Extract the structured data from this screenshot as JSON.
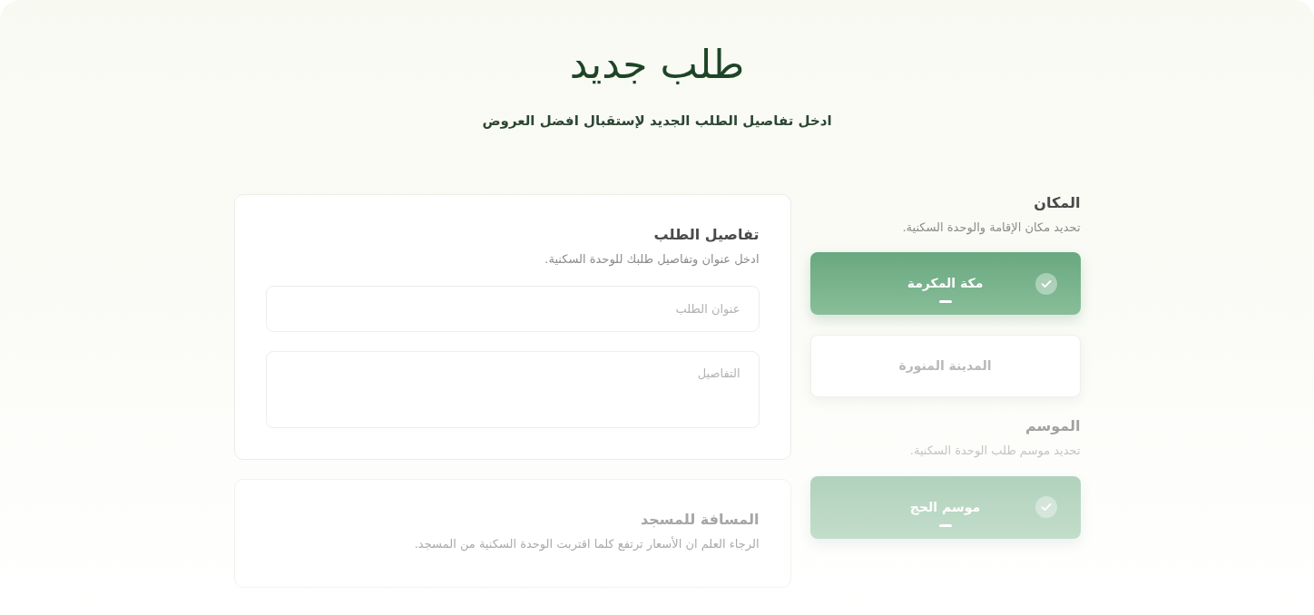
{
  "header": {
    "title": "طلب جديد",
    "subtitle": "ادخل تفاصيل الطلب الجديد لإستقبال افضل العروض"
  },
  "location": {
    "title": "المكان",
    "subtitle": "تحديد مكان الإقامة والوحدة السكنية.",
    "options": [
      {
        "label": "مكة المكرمة",
        "selected": true
      },
      {
        "label": "المدينة المنورة",
        "selected": false
      }
    ]
  },
  "season": {
    "title": "الموسم",
    "subtitle": "تحديد موسم طلب الوحدة السكنية.",
    "options": [
      {
        "label": "موسم الحج",
        "selected": true
      }
    ]
  },
  "request_details": {
    "title": "تفاصيل الطلب",
    "subtitle": "ادخل عنوان وتفاصيل طلبك للوحدة السكنية.",
    "fields": [
      {
        "kind": "input",
        "placeholder": "عنوان الطلب"
      },
      {
        "kind": "textarea",
        "placeholder": "التفاصيل"
      }
    ]
  },
  "mosque_distance": {
    "title": "المسافة للمسجد",
    "subtitle": "الرجاء العلم ان الأسعار ترتفع كلما اقتربت الوحدة السكنية من المسجد."
  }
}
